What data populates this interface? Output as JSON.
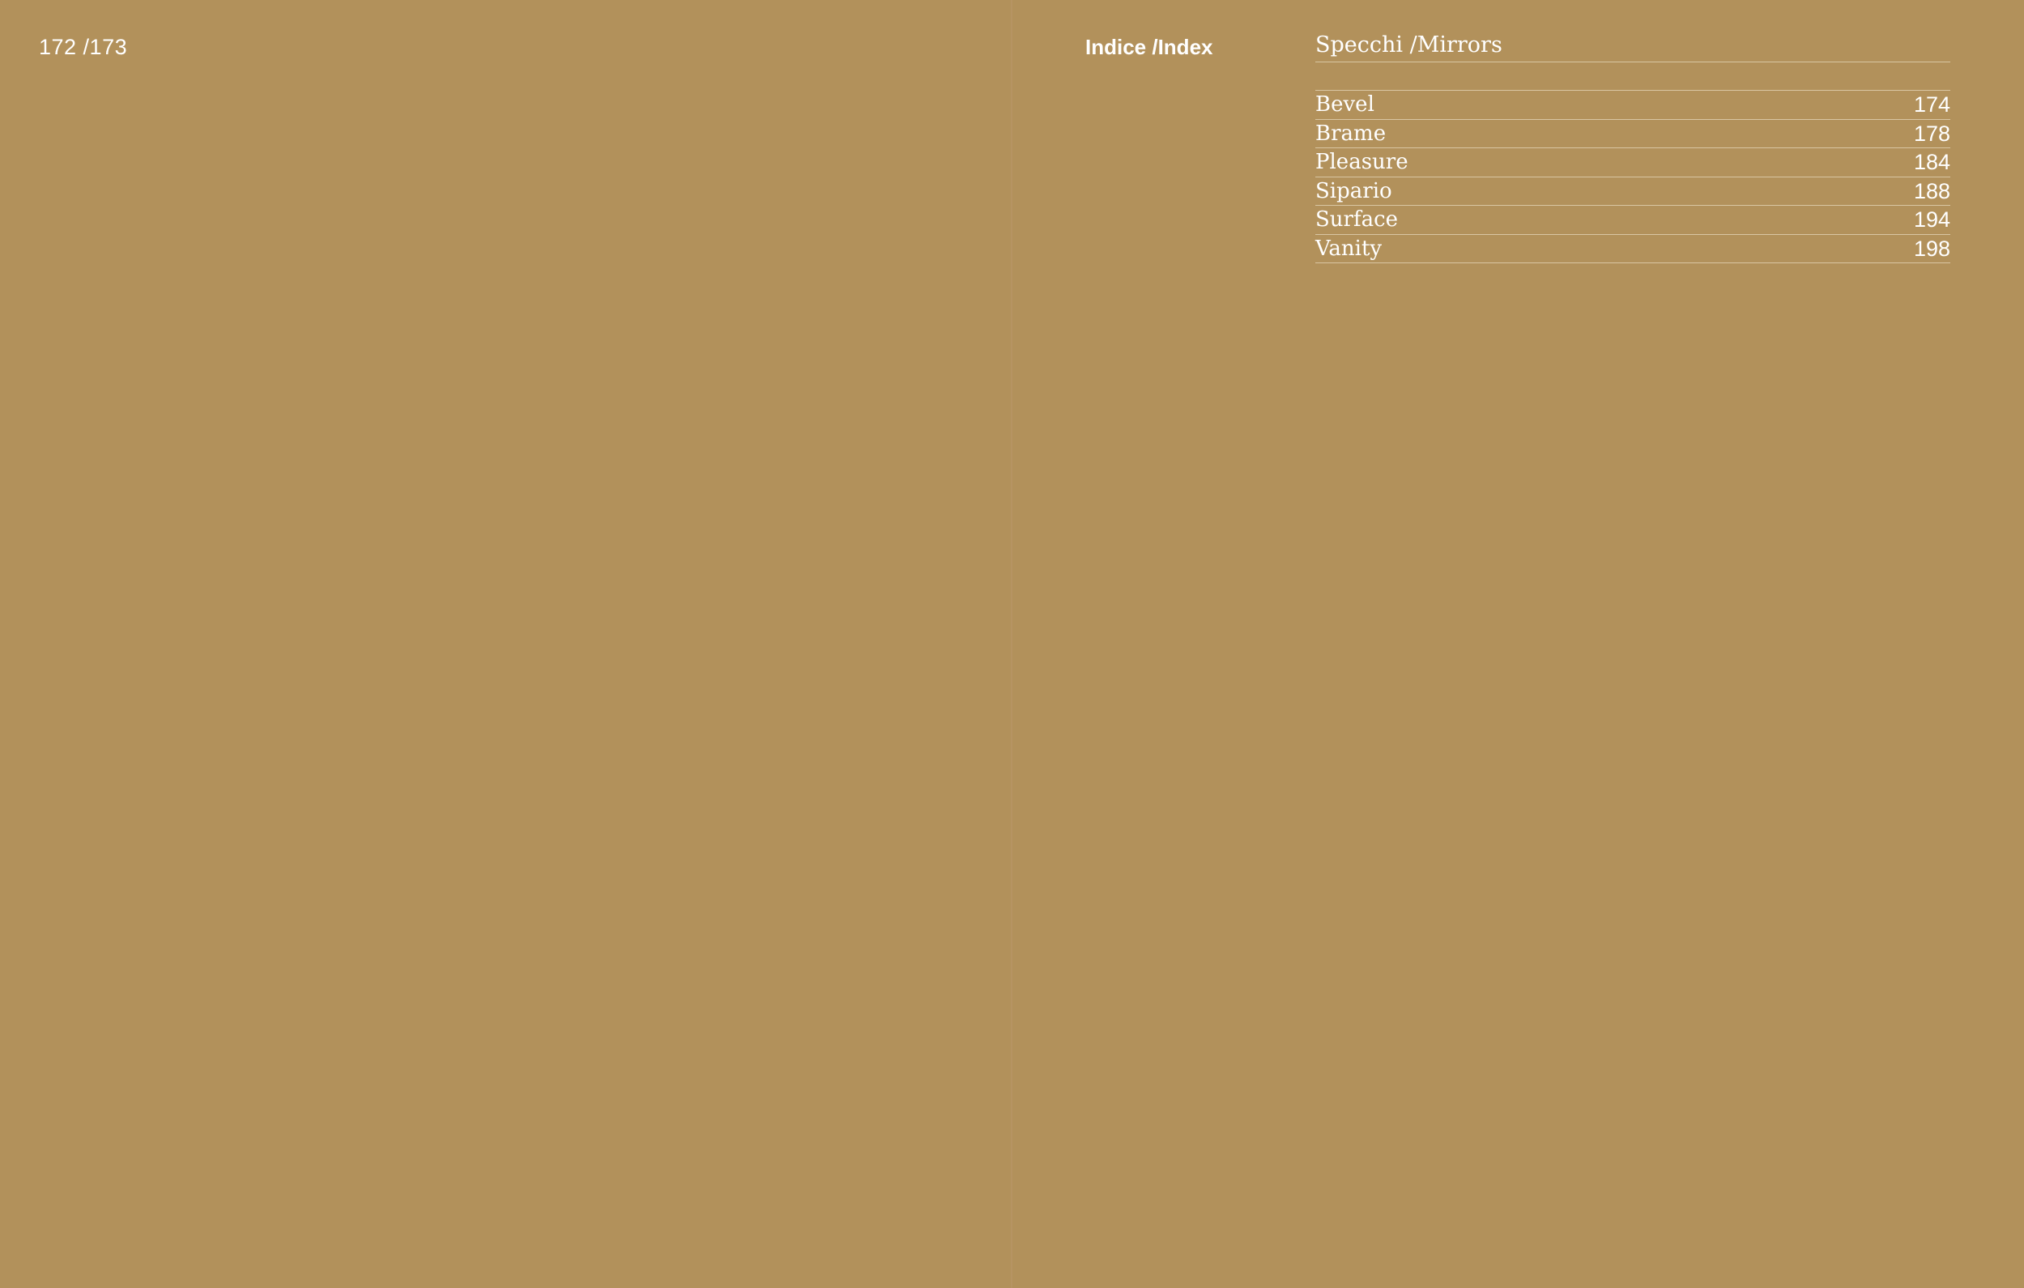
{
  "left_page": {
    "page_numbers": "172 /173"
  },
  "right_page": {
    "index_label": "Indice /Index",
    "section": {
      "title": "Specchi /Mirrors",
      "entries": [
        {
          "name": "Bevel",
          "page": "174"
        },
        {
          "name": "Brame",
          "page": "178"
        },
        {
          "name": "Pleasure",
          "page": "184"
        },
        {
          "name": "Sipario",
          "page": "188"
        },
        {
          "name": "Surface",
          "page": "194"
        },
        {
          "name": "Vanity",
          "page": "198"
        }
      ]
    }
  },
  "colors": {
    "background": "#b2915b",
    "text": "#ffffff",
    "rule": "#d9c6a3"
  }
}
